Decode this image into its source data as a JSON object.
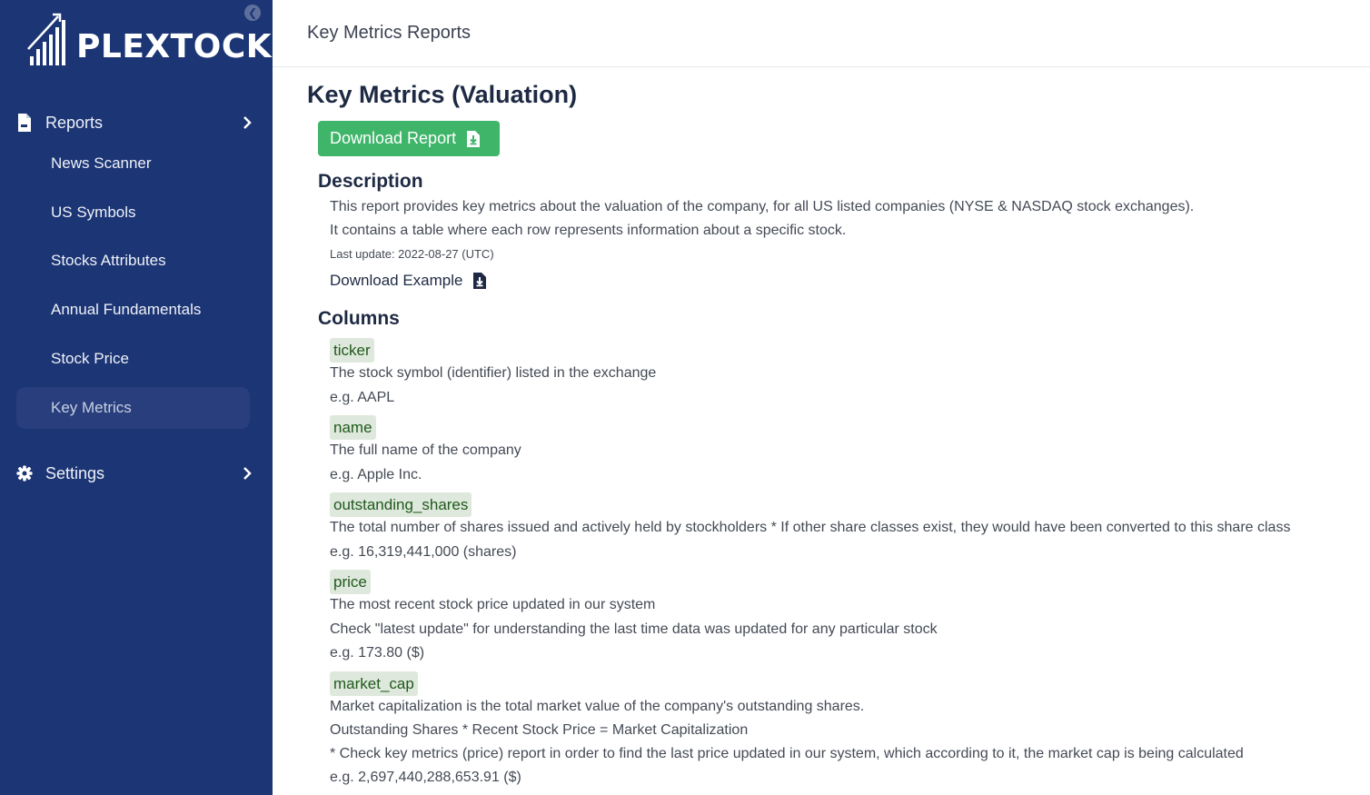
{
  "sidebar": {
    "brand": "PLEXTOCK",
    "sections": [
      {
        "label": "Reports",
        "icon": "file-icon"
      },
      {
        "label": "Settings",
        "icon": "gear-icon"
      }
    ],
    "items": [
      {
        "label": "News Scanner"
      },
      {
        "label": "US Symbols"
      },
      {
        "label": "Stocks Attributes"
      },
      {
        "label": "Annual Fundamentals"
      },
      {
        "label": "Stock Price"
      },
      {
        "label": "Key Metrics",
        "active": true
      }
    ]
  },
  "header": {
    "title": "Key Metrics Reports"
  },
  "page": {
    "title": "Key Metrics (Valuation)",
    "download_label": "Download Report",
    "description_heading": "Description",
    "description_lines": [
      "This report provides key metrics about the valuation of the company, for all US listed companies (NYSE & NASDAQ stock exchanges).",
      "It contains a table where each row represents information about a specific stock."
    ],
    "last_update": "Last update: 2022-08-27 (UTC)",
    "download_example_label": "Download Example",
    "columns_heading": "Columns",
    "columns": [
      {
        "name": "ticker",
        "lines": [
          "The stock symbol (identifier) listed in the exchange",
          "e.g. AAPL"
        ]
      },
      {
        "name": "name",
        "lines": [
          "The full name of the company",
          "e.g. Apple Inc."
        ]
      },
      {
        "name": "outstanding_shares",
        "lines": [
          "The total number of shares issued and actively held by stockholders * If other share classes exist, they would have been converted to this share class",
          "e.g. 16,319,441,000 (shares)"
        ]
      },
      {
        "name": "price",
        "lines": [
          "The most recent stock price updated in our system",
          "Check \"latest update\" for understanding the last time data was updated for any particular stock",
          "e.g. 173.80 ($)"
        ]
      },
      {
        "name": "market_cap",
        "lines": [
          "Market capitalization is the total market value of the company's outstanding shares.",
          "Outstanding Shares * Recent Stock Price = Market Capitalization",
          "* Check key metrics (price) report in order to find the last price updated in our system, which according to it, the market cap is being calculated",
          "e.g. 2,697,440,288,653.91 ($)"
        ]
      }
    ]
  },
  "colors": {
    "sidebar_bg": "#1c3574",
    "active_item_bg": "#293f7d",
    "button_green": "#3fb56a",
    "code_bg": "#dfe8dc",
    "code_text": "#1f5a1c"
  }
}
